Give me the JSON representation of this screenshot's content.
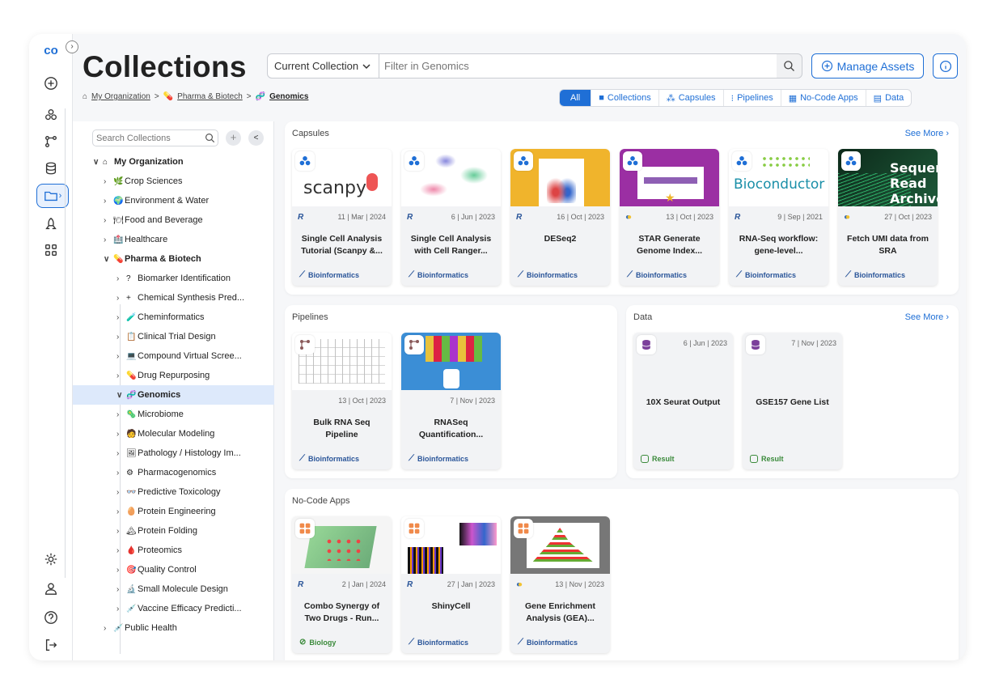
{
  "rail": {
    "logo": "co",
    "collapse_glyph": "›",
    "active_chevron": "›"
  },
  "header": {
    "title": "Collections",
    "scope_select": "Current Collection",
    "search_placeholder": "Filter in Genomics",
    "manage_button": "Manage Assets"
  },
  "breadcrumb": {
    "items": [
      "My Organization",
      "Pharma & Biotech",
      "Genomics"
    ],
    "separator": ">"
  },
  "filters": {
    "tabs": [
      "All",
      "Collections",
      "Capsules",
      "Pipelines",
      "No-Code Apps",
      "Data"
    ],
    "active": "All"
  },
  "tree": {
    "search_placeholder": "Search Collections",
    "root": "My Organization",
    "items": [
      {
        "label": "Crop Sciences",
        "emoji": "🌿"
      },
      {
        "label": "Environment & Water",
        "emoji": "🌍"
      },
      {
        "label": "Food and Beverage",
        "emoji": "🍽"
      },
      {
        "label": "Healthcare",
        "emoji": "🏥"
      },
      {
        "label": "Pharma & Biotech",
        "emoji": "💊"
      },
      {
        "label": "Biomarker Identification",
        "emoji": "?"
      },
      {
        "label": "Chemical Synthesis Pred...",
        "emoji": "+"
      },
      {
        "label": "Cheminformatics",
        "emoji": "🧪"
      },
      {
        "label": "Clinical Trial Design",
        "emoji": "📋"
      },
      {
        "label": "Compound Virtual Scree...",
        "emoji": "💻"
      },
      {
        "label": "Drug Repurposing",
        "emoji": "💊"
      },
      {
        "label": "Genomics",
        "emoji": "🧬"
      },
      {
        "label": "Microbiome",
        "emoji": "🦠"
      },
      {
        "label": "Molecular Modeling",
        "emoji": "🧑"
      },
      {
        "label": "Pathology / Histology Im...",
        "emoji": "🖼"
      },
      {
        "label": "Pharmacogenomics",
        "emoji": "⚙"
      },
      {
        "label": "Predictive Toxicology",
        "emoji": "👓"
      },
      {
        "label": "Protein Engineering",
        "emoji": "🥚"
      },
      {
        "label": "Protein Folding",
        "emoji": "🏔"
      },
      {
        "label": "Proteomics",
        "emoji": "🩸"
      },
      {
        "label": "Quality Control",
        "emoji": "🎯"
      },
      {
        "label": "Small Molecule Design",
        "emoji": "🔬"
      },
      {
        "label": "Vaccine Efficacy Predicti...",
        "emoji": "💉"
      },
      {
        "label": "Public Health",
        "emoji": "💉"
      }
    ]
  },
  "capsules": {
    "title": "Capsules",
    "see_more": "See More",
    "cards": [
      {
        "lang": "R",
        "date": "11 | Mar | 2024",
        "title": "Single Cell Analysis Tutorial (Scanpy &...",
        "tag": "Bioinformatics",
        "thumb_text": "scanpy"
      },
      {
        "lang": "R",
        "date": "6 | Jun | 2023",
        "title": "Single Cell Analysis with Cell Ranger...",
        "tag": "Bioinformatics"
      },
      {
        "lang": "R",
        "date": "16 | Oct | 2023",
        "title": "DESeq2",
        "tag": "Bioinformatics"
      },
      {
        "lang": "py",
        "date": "13 | Oct | 2023",
        "title": "STAR Generate Genome Index...",
        "tag": "Bioinformatics"
      },
      {
        "lang": "R",
        "date": "9 | Sep | 2021",
        "title": "RNA-Seq workflow: gene-level...",
        "tag": "Bioinformatics",
        "thumb_text": "Bioconductor"
      },
      {
        "lang": "py",
        "date": "27 | Oct | 2023",
        "title": "Fetch UMI data from SRA",
        "tag": "Bioinformatics",
        "thumb_lines": [
          "Sequence",
          "Read",
          "Archive"
        ]
      }
    ]
  },
  "pipelines": {
    "title": "Pipelines",
    "cards": [
      {
        "date": "13 | Oct | 2023",
        "title": "Bulk RNA Seq Pipeline",
        "tag": "Bioinformatics"
      },
      {
        "date": "7 | Nov | 2023",
        "title": "RNASeq Quantification...",
        "tag": "Bioinformatics"
      }
    ]
  },
  "data": {
    "title": "Data",
    "see_more": "See More",
    "cards": [
      {
        "date": "6 | Jun | 2023",
        "title": "10X Seurat Output",
        "tag": "Result"
      },
      {
        "date": "7 | Nov | 2023",
        "title": "GSE157 Gene List",
        "tag": "Result"
      }
    ]
  },
  "nocode": {
    "title": "No-Code Apps",
    "cards": [
      {
        "lang": "R",
        "date": "2 | Jan | 2024",
        "title": "Combo Synergy of Two Drugs - Run...",
        "tag": "Biology"
      },
      {
        "lang": "R",
        "date": "27 | Jan | 2023",
        "title": "ShinyCell",
        "tag": "Bioinformatics"
      },
      {
        "lang": "py",
        "date": "13 | Nov | 2023",
        "title": "Gene Enrichment Analysis (GEA)...",
        "tag": "Bioinformatics"
      }
    ]
  },
  "colors": {
    "accent": "#1f6fd6",
    "tag": "#2a5599",
    "green": "#3a8a3a"
  }
}
